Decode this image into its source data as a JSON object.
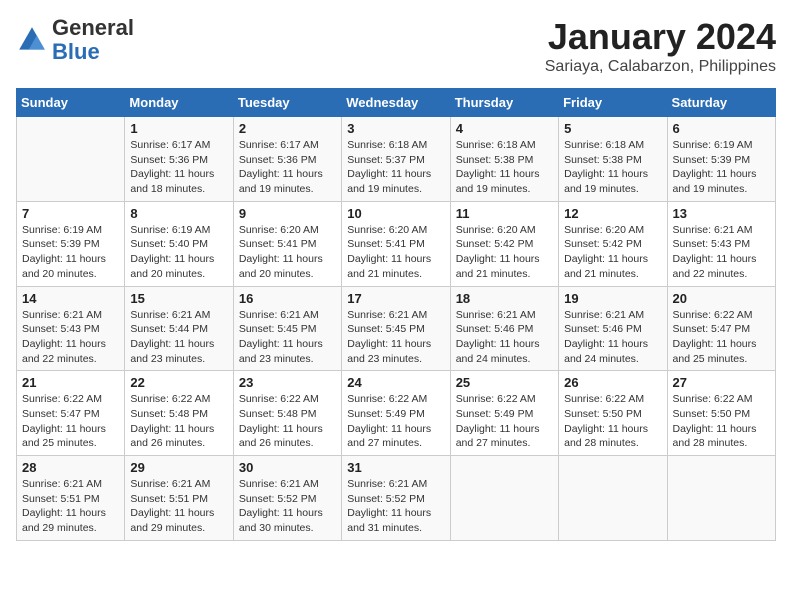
{
  "header": {
    "logo_general": "General",
    "logo_blue": "Blue",
    "month_title": "January 2024",
    "subtitle": "Sariaya, Calabarzon, Philippines"
  },
  "days_of_week": [
    "Sunday",
    "Monday",
    "Tuesday",
    "Wednesday",
    "Thursday",
    "Friday",
    "Saturday"
  ],
  "weeks": [
    [
      {
        "day": "",
        "info": ""
      },
      {
        "day": "1",
        "info": "Sunrise: 6:17 AM\nSunset: 5:36 PM\nDaylight: 11 hours\nand 18 minutes."
      },
      {
        "day": "2",
        "info": "Sunrise: 6:17 AM\nSunset: 5:36 PM\nDaylight: 11 hours\nand 19 minutes."
      },
      {
        "day": "3",
        "info": "Sunrise: 6:18 AM\nSunset: 5:37 PM\nDaylight: 11 hours\nand 19 minutes."
      },
      {
        "day": "4",
        "info": "Sunrise: 6:18 AM\nSunset: 5:38 PM\nDaylight: 11 hours\nand 19 minutes."
      },
      {
        "day": "5",
        "info": "Sunrise: 6:18 AM\nSunset: 5:38 PM\nDaylight: 11 hours\nand 19 minutes."
      },
      {
        "day": "6",
        "info": "Sunrise: 6:19 AM\nSunset: 5:39 PM\nDaylight: 11 hours\nand 19 minutes."
      }
    ],
    [
      {
        "day": "7",
        "info": "Sunrise: 6:19 AM\nSunset: 5:39 PM\nDaylight: 11 hours\nand 20 minutes."
      },
      {
        "day": "8",
        "info": "Sunrise: 6:19 AM\nSunset: 5:40 PM\nDaylight: 11 hours\nand 20 minutes."
      },
      {
        "day": "9",
        "info": "Sunrise: 6:20 AM\nSunset: 5:41 PM\nDaylight: 11 hours\nand 20 minutes."
      },
      {
        "day": "10",
        "info": "Sunrise: 6:20 AM\nSunset: 5:41 PM\nDaylight: 11 hours\nand 21 minutes."
      },
      {
        "day": "11",
        "info": "Sunrise: 6:20 AM\nSunset: 5:42 PM\nDaylight: 11 hours\nand 21 minutes."
      },
      {
        "day": "12",
        "info": "Sunrise: 6:20 AM\nSunset: 5:42 PM\nDaylight: 11 hours\nand 21 minutes."
      },
      {
        "day": "13",
        "info": "Sunrise: 6:21 AM\nSunset: 5:43 PM\nDaylight: 11 hours\nand 22 minutes."
      }
    ],
    [
      {
        "day": "14",
        "info": "Sunrise: 6:21 AM\nSunset: 5:43 PM\nDaylight: 11 hours\nand 22 minutes."
      },
      {
        "day": "15",
        "info": "Sunrise: 6:21 AM\nSunset: 5:44 PM\nDaylight: 11 hours\nand 23 minutes."
      },
      {
        "day": "16",
        "info": "Sunrise: 6:21 AM\nSunset: 5:45 PM\nDaylight: 11 hours\nand 23 minutes."
      },
      {
        "day": "17",
        "info": "Sunrise: 6:21 AM\nSunset: 5:45 PM\nDaylight: 11 hours\nand 23 minutes."
      },
      {
        "day": "18",
        "info": "Sunrise: 6:21 AM\nSunset: 5:46 PM\nDaylight: 11 hours\nand 24 minutes."
      },
      {
        "day": "19",
        "info": "Sunrise: 6:21 AM\nSunset: 5:46 PM\nDaylight: 11 hours\nand 24 minutes."
      },
      {
        "day": "20",
        "info": "Sunrise: 6:22 AM\nSunset: 5:47 PM\nDaylight: 11 hours\nand 25 minutes."
      }
    ],
    [
      {
        "day": "21",
        "info": "Sunrise: 6:22 AM\nSunset: 5:47 PM\nDaylight: 11 hours\nand 25 minutes."
      },
      {
        "day": "22",
        "info": "Sunrise: 6:22 AM\nSunset: 5:48 PM\nDaylight: 11 hours\nand 26 minutes."
      },
      {
        "day": "23",
        "info": "Sunrise: 6:22 AM\nSunset: 5:48 PM\nDaylight: 11 hours\nand 26 minutes."
      },
      {
        "day": "24",
        "info": "Sunrise: 6:22 AM\nSunset: 5:49 PM\nDaylight: 11 hours\nand 27 minutes."
      },
      {
        "day": "25",
        "info": "Sunrise: 6:22 AM\nSunset: 5:49 PM\nDaylight: 11 hours\nand 27 minutes."
      },
      {
        "day": "26",
        "info": "Sunrise: 6:22 AM\nSunset: 5:50 PM\nDaylight: 11 hours\nand 28 minutes."
      },
      {
        "day": "27",
        "info": "Sunrise: 6:22 AM\nSunset: 5:50 PM\nDaylight: 11 hours\nand 28 minutes."
      }
    ],
    [
      {
        "day": "28",
        "info": "Sunrise: 6:21 AM\nSunset: 5:51 PM\nDaylight: 11 hours\nand 29 minutes."
      },
      {
        "day": "29",
        "info": "Sunrise: 6:21 AM\nSunset: 5:51 PM\nDaylight: 11 hours\nand 29 minutes."
      },
      {
        "day": "30",
        "info": "Sunrise: 6:21 AM\nSunset: 5:52 PM\nDaylight: 11 hours\nand 30 minutes."
      },
      {
        "day": "31",
        "info": "Sunrise: 6:21 AM\nSunset: 5:52 PM\nDaylight: 11 hours\nand 31 minutes."
      },
      {
        "day": "",
        "info": ""
      },
      {
        "day": "",
        "info": ""
      },
      {
        "day": "",
        "info": ""
      }
    ]
  ]
}
